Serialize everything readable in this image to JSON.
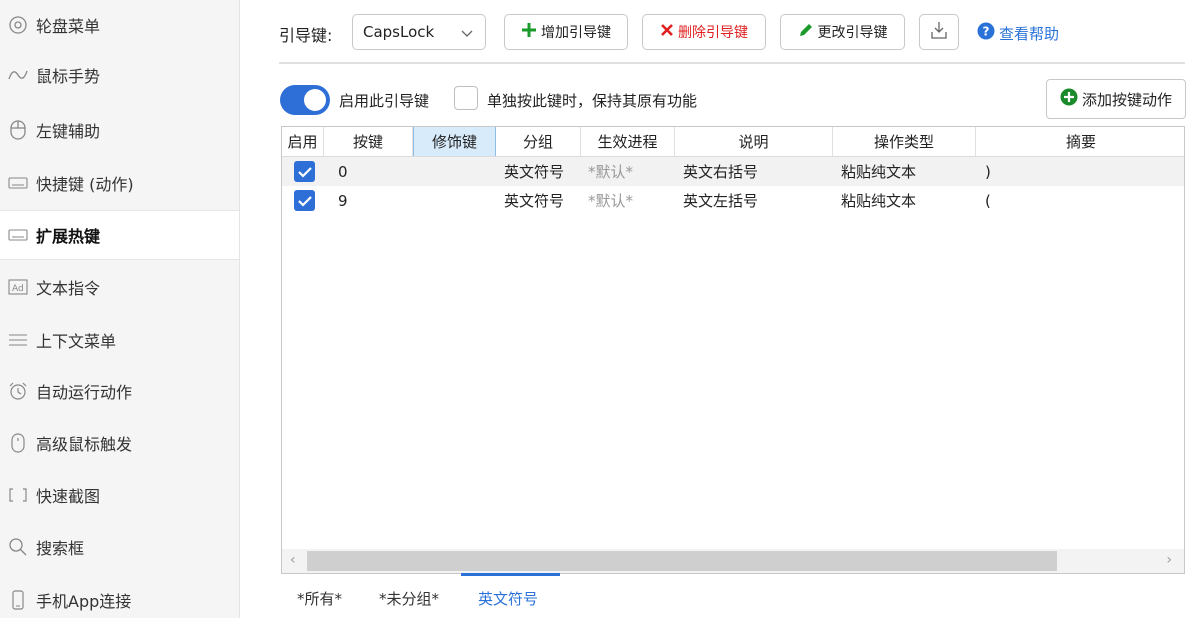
{
  "sidebar": {
    "items": [
      {
        "label": "轮盘菜单",
        "icon": "wheel-menu-icon"
      },
      {
        "label": "鼠标手势",
        "icon": "mouse-gesture-icon"
      },
      {
        "label": "左键辅助",
        "icon": "left-click-assist-icon"
      },
      {
        "label": "快捷键 (动作)",
        "icon": "keyboard-icon"
      },
      {
        "label": "扩展热键",
        "icon": "keyboard-icon",
        "active": true
      },
      {
        "label": "文本指令",
        "icon": "ad-text-icon"
      },
      {
        "label": "上下文菜单",
        "icon": "menu-lines-icon"
      },
      {
        "label": "自动运行动作",
        "icon": "alarm-clock-icon"
      },
      {
        "label": "高级鼠标触发",
        "icon": "mouse-icon"
      },
      {
        "label": "快速截图",
        "icon": "screenshot-bracket-icon"
      },
      {
        "label": "搜索框",
        "icon": "search-icon"
      },
      {
        "label": "手机App连接",
        "icon": "phone-icon"
      }
    ]
  },
  "toolbar": {
    "lead_label": "引导键:",
    "lead_key_value": "CapsLock",
    "add_label": "增加引导键",
    "delete_label": "删除引导键",
    "edit_label": "更改引导键",
    "help_label": "查看帮助"
  },
  "options": {
    "enable_label": "启用此引导键",
    "enable_on": true,
    "keep_function_label": "单独按此键时，保持其原有功能",
    "keep_function_checked": false,
    "add_action_label": "添加按键动作"
  },
  "table": {
    "headers": [
      "启用",
      "按键",
      "修饰键",
      "分组",
      "生效进程",
      "说明",
      "操作类型",
      "摘要"
    ],
    "rows": [
      {
        "enabled": true,
        "key": "0",
        "modifier": "",
        "group": "英文符号",
        "process": "*默认*",
        "desc": "英文右括号",
        "action": "粘贴纯文本",
        "summary": ")"
      },
      {
        "enabled": true,
        "key": "9",
        "modifier": "",
        "group": "英文符号",
        "process": "*默认*",
        "desc": "英文左括号",
        "action": "粘贴纯文本",
        "summary": "("
      }
    ]
  },
  "group_tabs": [
    "*所有*",
    "*未分组*",
    "英文符号"
  ],
  "colors": {
    "accent": "#2d6fd6",
    "delete": "#e02020",
    "add": "#1a9a2a"
  }
}
